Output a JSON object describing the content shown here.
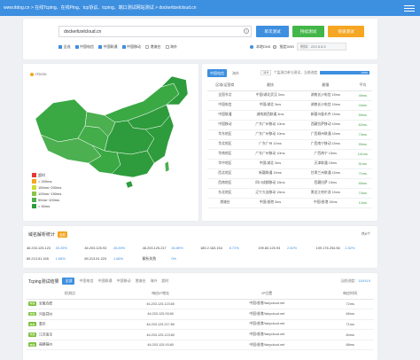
{
  "topbar": {
    "breadcrumb": "www.itdog.cn  >  在线Tcping、在线Ping、tcp协议、tcping、端口测试网站测试  >  dockerlizelcloud.cn"
  },
  "search": {
    "domain": "dockerlizelcloud.cn",
    "clear_icon": "×",
    "buttons": {
      "single": "单次测试",
      "multi": "持续测试",
      "fast": "快速测试"
    },
    "filters": [
      {
        "label": "全选",
        "on": true
      },
      {
        "label": "中国电信",
        "on": true
      },
      {
        "label": "中国联通",
        "on": true
      },
      {
        "label": "中国移动",
        "on": true
      },
      {
        "label": "港澳台",
        "on": false
      },
      {
        "label": "海外",
        "on": false
      }
    ],
    "dns_options": [
      "本地DNS",
      "指定DNS"
    ],
    "dns_placeholder": "例如：223.5.5.5"
  },
  "map": {
    "logo": "ITDOG",
    "legend": [
      {
        "label": "超时",
        "color": "#e53935"
      },
      {
        "label": "> 200ms",
        "color": "#f5a623"
      },
      {
        "label": "150ms~200ms",
        "color": "#cddc39"
      },
      {
        "label": "100ms~150ms",
        "color": "#8bc34a"
      },
      {
        "label": "50ms~100ms",
        "color": "#4caf50"
      },
      {
        "label": "< 50ms",
        "color": "#2e9c3c"
      }
    ]
  },
  "stats": {
    "tabs": [
      "中国电信",
      "海外"
    ],
    "progress": {
      "count": "119",
      "text": "个监测点参与测试，当前进度",
      "percent": 100,
      "percent_label": "100%"
    },
    "columns": [
      "区域/运营商",
      "最快",
      "最慢",
      "平均"
    ],
    "rows": [
      [
        "全国节点",
        "中国/湖北武汉 3ms",
        "湖南长沙电信 15ms",
        "49ms"
      ],
      [
        "中国电信",
        "中国/湖北 3ms",
        "湖南长沙电信 15ms",
        "44ms"
      ],
      [
        "中国联通",
        "湖南湘西联通 3ms",
        "新疆乌鲁木齐 15ms",
        "59ms"
      ],
      [
        "中国移动",
        "广东广州移动 10ms",
        "西藏拉萨移动 15ms",
        "62ms"
      ],
      [
        "华东地区",
        "广东广州移动 10ms",
        "广西柳州联通 15ms",
        "74ms"
      ],
      [
        "华北地区",
        "广东广州 10ms",
        "广西南宁移动 15ms",
        "59ms"
      ],
      [
        "华南地区",
        "广东广州移动 10ms",
        "广西南宁 15ms",
        "141ms"
      ],
      [
        "华中地区",
        "中国/湖北 3ms",
        "天津联通 15ms",
        "51ms"
      ],
      [
        "西北地区",
        "新疆联通 15ms",
        "甘肃兰州联通 15ms",
        "71ms"
      ],
      [
        "西南地区",
        "四川成都移动 15ms",
        "西藏拉萨 15ms",
        "65ms"
      ],
      [
        "东北地区",
        "辽宁大连移动 15ms",
        "黑龙江哈尔滨 15ms",
        "74ms"
      ],
      [
        "港澳台",
        "中国/香港 3ms",
        "中国/香港 15ms",
        "12ms"
      ]
    ]
  },
  "parse": {
    "title": "域名解析统计",
    "badge": "全部",
    "right": "共6个",
    "cells": [
      [
        "46.203.125.123",
        "30.25%",
        "46.203.125.93",
        "26.89%",
        "46.203.125.217",
        "26.89%",
        "185.2.163.154",
        "8.72%",
        "199.80.125.93",
        "2.52%",
        "109.176.254.56",
        "2.52%"
      ],
      [
        "89.213.51.165",
        "1.68%",
        "89.213.51.223",
        "1.68%",
        "解析失败",
        "0%"
      ]
    ]
  },
  "results": {
    "title": "Tcping测试结果",
    "filters": [
      "全部",
      "中国电信",
      "中国联通",
      "中国移动",
      "港澳台",
      "海外",
      "超时"
    ],
    "count_label": "当前进度：",
    "count": "119/119",
    "columns": [
      "检测点",
      "响应IP地址",
      "IP位置",
      "响应时间"
    ],
    "rows": [
      {
        "tag": "电信",
        "node": "安徽合肥",
        "ip": "46.203.125.123:80",
        "loc": "中国/香港/fairycloud.net",
        "time": "72ms"
      },
      {
        "tag": "电信",
        "node": "河南郑州",
        "ip": "46.203.125.93:80",
        "loc": "中国/香港/fairycloud.net",
        "time": "66ms"
      },
      {
        "tag": "电信",
        "node": "重庆",
        "ip": "46.203.125.217:80",
        "loc": "中国/香港/fairycloud.net",
        "time": "71ms"
      },
      {
        "tag": "电信",
        "node": "江苏南京",
        "ip": "46.203.125.123:80",
        "loc": "中国/香港/fairycloud.net",
        "time": "84ms"
      },
      {
        "tag": "电信",
        "node": "福建福州",
        "ip": "46.203.125.93:80",
        "loc": "中国/香港/fairycloud.net",
        "time": "88ms"
      }
    ]
  }
}
